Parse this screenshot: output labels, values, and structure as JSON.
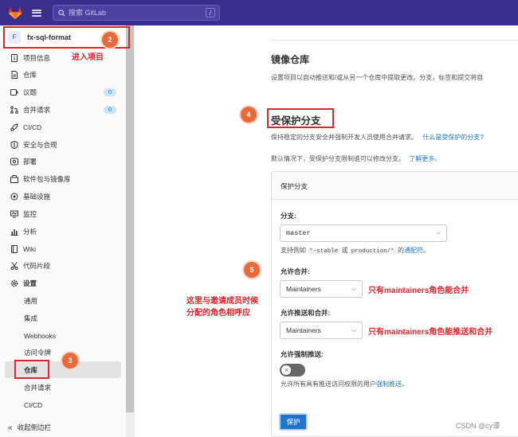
{
  "topbar": {
    "search_placeholder": "搜索 GitLab",
    "search_shortcut": "/"
  },
  "project": {
    "avatar": "F",
    "name": "fx-sql-format"
  },
  "sidebar": {
    "items": [
      {
        "label": "项目信息",
        "icon": "info-icon"
      },
      {
        "label": "仓库",
        "icon": "doc-icon"
      },
      {
        "label": "议题",
        "icon": "issue-icon",
        "badge": "0"
      },
      {
        "label": "合并请求",
        "icon": "merge-icon",
        "badge": "0"
      },
      {
        "label": "CI/CD",
        "icon": "rocket-icon"
      },
      {
        "label": "安全与合规",
        "icon": "shield-icon"
      },
      {
        "label": "部署",
        "icon": "deploy-icon"
      },
      {
        "label": "软件包与镜像库",
        "icon": "package-icon"
      },
      {
        "label": "基础设施",
        "icon": "cloud-icon"
      },
      {
        "label": "监控",
        "icon": "monitor-icon"
      },
      {
        "label": "分析",
        "icon": "chart-icon"
      },
      {
        "label": "Wiki",
        "icon": "book-icon"
      },
      {
        "label": "代码片段",
        "icon": "scissors-icon"
      },
      {
        "label": "设置",
        "icon": "gear-icon"
      }
    ],
    "settings_sub": [
      "通用",
      "集成",
      "Webhooks",
      "访问令牌",
      "仓库",
      "合并请求",
      "CI/CD"
    ],
    "collapse_label": "收起侧边栏"
  },
  "annotations": {
    "n1": "2",
    "t1": "进入项目",
    "n2": "3",
    "n3": "4",
    "n4": "5",
    "t2_line1": "这里与邀请成员时候",
    "t2_line2": "分配的角色相呼应",
    "t3": "只有maintainers角色能合并",
    "t4": "只有maintainers角色能推送和合并"
  },
  "main": {
    "mirror_title": "镜像仓库",
    "mirror_desc": "设置项目以自动推送和/或从另一个仓库中提取更改。分支，标签和提交将自",
    "protect_title": "受保护分支",
    "protect_desc": "保持稳定的分支安全并强制开发人员使用合并请求。",
    "protect_link": "什么是受保护的分支?",
    "default_desc": "默认情况下，受保护分支限制谁可以修改分支。",
    "learn_more": "了解更多。",
    "card_title": "保护分支",
    "branch_label": "分支:",
    "branch_value": "master",
    "hint_prefix": "支持例如",
    "hint_code1": "*-stable",
    "hint_or": "或",
    "hint_code2": "production/*",
    "hint_of": "的",
    "hint_link": "通配符",
    "hint_end": "。",
    "merge_label": "允许合并:",
    "merge_value": "Maintainers",
    "push_label": "允许推送和合并:",
    "push_value": "Maintainers",
    "force_label": "允许强制推送:",
    "force_desc": "允许所有具有推送访问权限的用户",
    "force_link": "强制推送",
    "force_end": "。",
    "protect_button": "保护"
  },
  "watermark": "CSDN @cy谭"
}
